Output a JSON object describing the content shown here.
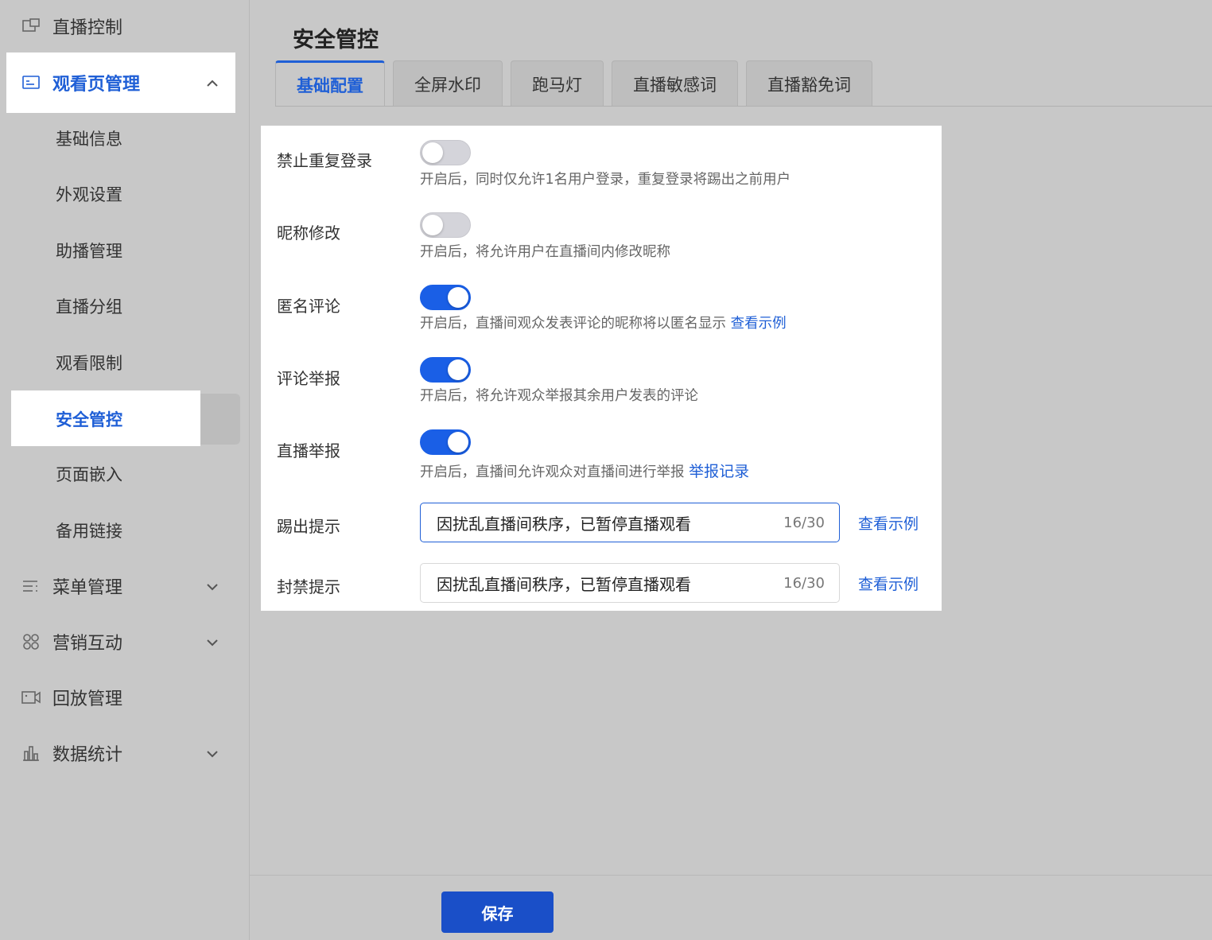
{
  "sidebar": {
    "live_control": "直播控制",
    "watch_page": "观看页管理",
    "sub_items": [
      "基础信息",
      "外观设置",
      "助播管理",
      "直播分组",
      "观看限制",
      "安全管控",
      "页面嵌入",
      "备用链接"
    ],
    "menu_mgmt": "菜单管理",
    "marketing": "营销互动",
    "replay": "回放管理",
    "stats": "数据统计"
  },
  "main": {
    "title": "安全管控",
    "tabs": [
      "基础配置",
      "全屏水印",
      "跑马灯",
      "直播敏感词",
      "直播豁免词"
    ],
    "settings": {
      "repeat_login": {
        "label": "禁止重复登录",
        "on": false,
        "desc": "开启后，同时仅允许1名用户登录，重复登录将踢出之前用户"
      },
      "nickname": {
        "label": "昵称修改",
        "on": false,
        "desc": "开启后，将允许用户在直播间内修改昵称"
      },
      "anonymous": {
        "label": "匿名评论",
        "on": true,
        "desc": "开启后，直播间观众发表评论的昵称将以匿名显示",
        "link": "查看示例"
      },
      "comment_report": {
        "label": "评论举报",
        "on": true,
        "desc": "开启后，将允许观众举报其余用户发表的评论"
      },
      "live_report": {
        "label": "直播举报",
        "on": true,
        "desc": "开启后，直播间允许观众对直播间进行举报",
        "link": "举报记录"
      },
      "kick_tip": {
        "label": "踢出提示",
        "value": "因扰乱直播间秩序，已暂停直播观看",
        "count": "16/30",
        "link": "查看示例"
      },
      "ban_tip": {
        "label": "封禁提示",
        "value": "因扰乱直播间秩序，已暂停直播观看",
        "count": "16/30",
        "link": "查看示例"
      }
    },
    "save_label": "保存"
  },
  "colors": {
    "accent": "#1f5fd6",
    "toggle_on": "#1a5fe6",
    "toggle_off": "#d4d4da"
  }
}
